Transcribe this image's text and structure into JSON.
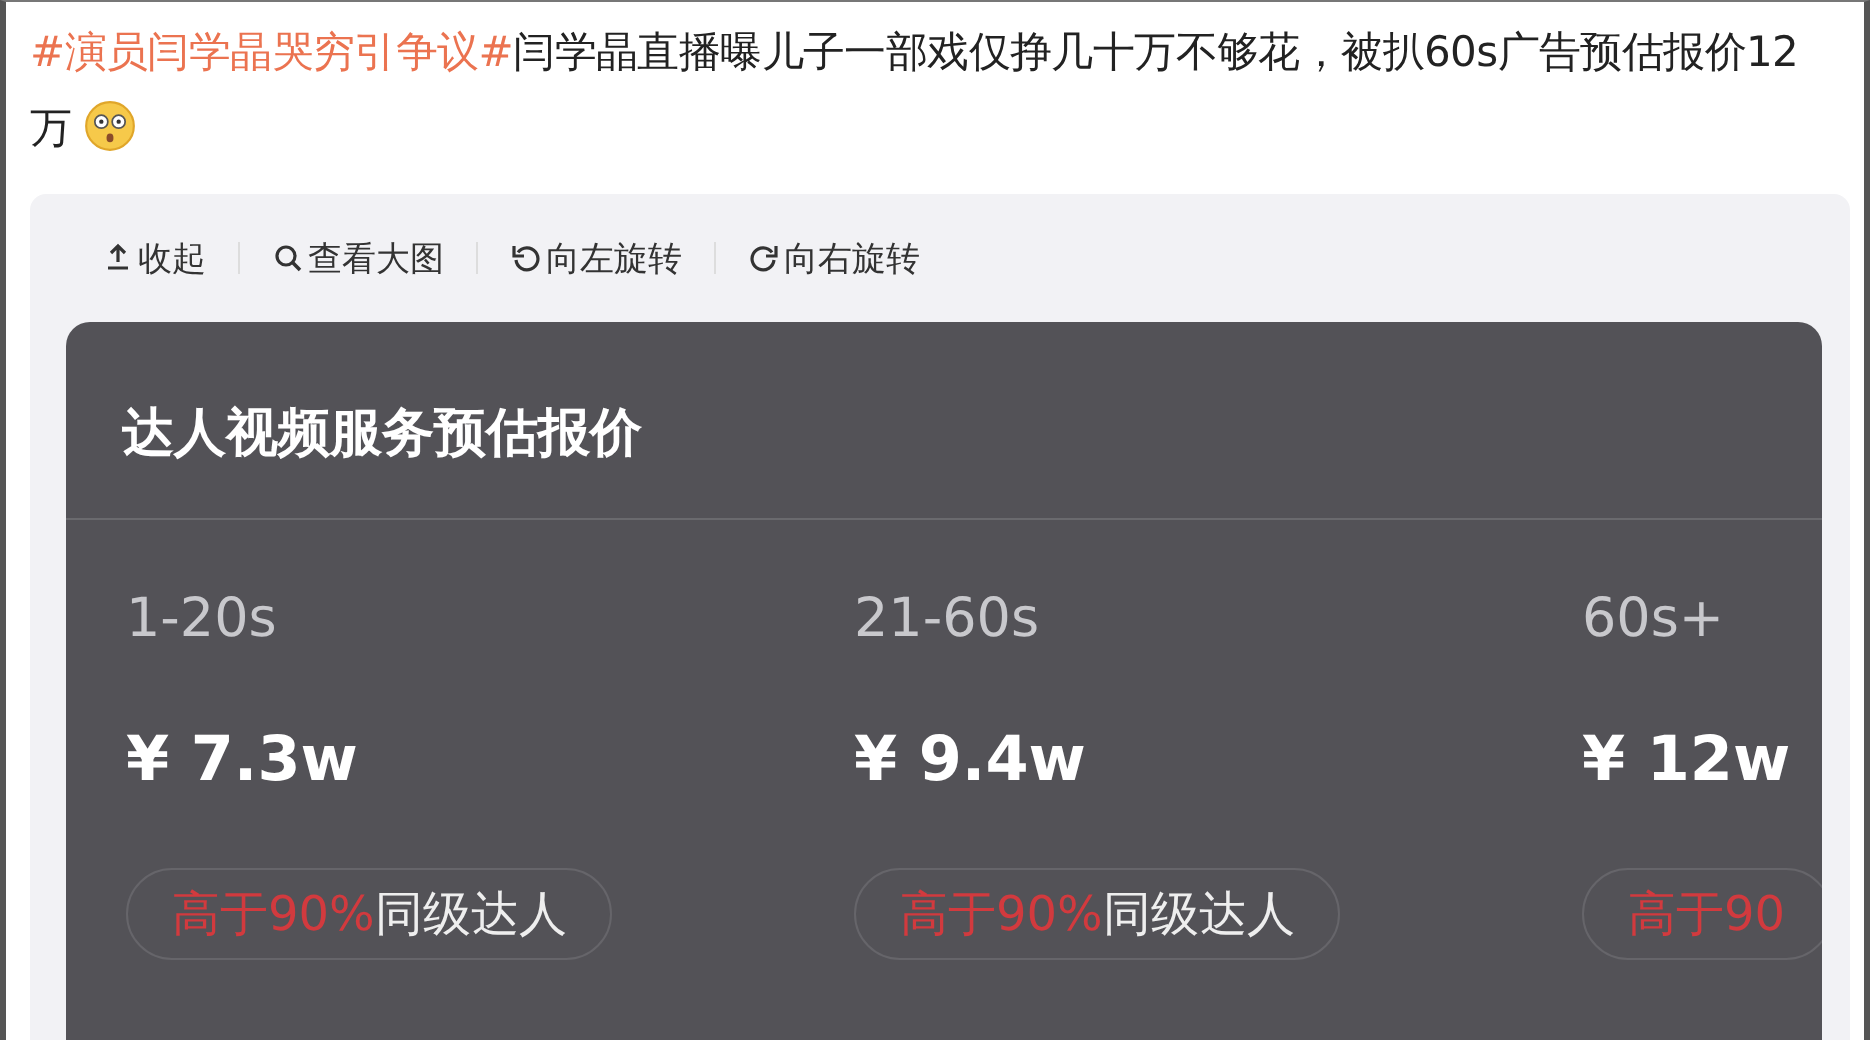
{
  "post": {
    "topic_link": "#演员闫学晶哭穷引争议#",
    "text": "闫学晶直播曝儿子一部戏仅挣几十万不够花，被扒60s广告预估报价12万"
  },
  "toolbar": [
    {
      "kind": "collapse",
      "label": "收起"
    },
    {
      "kind": "zoom",
      "label": "查看大图"
    },
    {
      "kind": "rotate-left",
      "label": "向左旋转"
    },
    {
      "kind": "rotate-right",
      "label": "向右旋转"
    }
  ],
  "image": {
    "title": "达人视频服务预估报价",
    "tiers": [
      {
        "duration": "1-20s",
        "price": "¥ 7.3w",
        "badge_highlight": "高于90%",
        "badge_text": "同级达人"
      },
      {
        "duration": "21-60s",
        "price": "¥ 9.4w",
        "badge_highlight": "高于90%",
        "badge_text": "同级达人"
      },
      {
        "duration": "60s+",
        "price": "¥ 12w",
        "badge_highlight": "高于90"
      }
    ]
  }
}
